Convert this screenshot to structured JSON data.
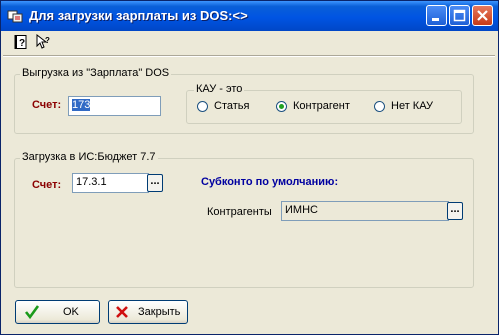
{
  "window": {
    "title": "Для загрузки зарплаты из DOS:<>"
  },
  "toolbar": {
    "help_icon": "help-book-icon",
    "whats_this_icon": "whats-this-icon"
  },
  "group_export": {
    "title": "Выгрузка из \"Зарплата\" DOS",
    "account_label": "Счет:",
    "account_value": "173",
    "kau": {
      "title": "КАУ - это",
      "options": [
        "Статья",
        "Контрагент",
        "Нет КАУ"
      ],
      "selected": "Контрагент"
    }
  },
  "group_import": {
    "title": "Загрузка в ИС:Бюджет 7.7",
    "account_label": "Счет:",
    "account_value": "17.3.1",
    "subconto_title": "Субконто по умолчанию:",
    "contractors_label": "Контрагенты",
    "contractors_value": "ИМНС"
  },
  "buttons": {
    "ok": "OK",
    "close": "Закрыть",
    "ellipsis": "..."
  },
  "colors": {
    "titlebar": "#0054e3",
    "red_label": "#8b0000",
    "blue_label": "#0000a0",
    "selection": "#316ac5"
  }
}
